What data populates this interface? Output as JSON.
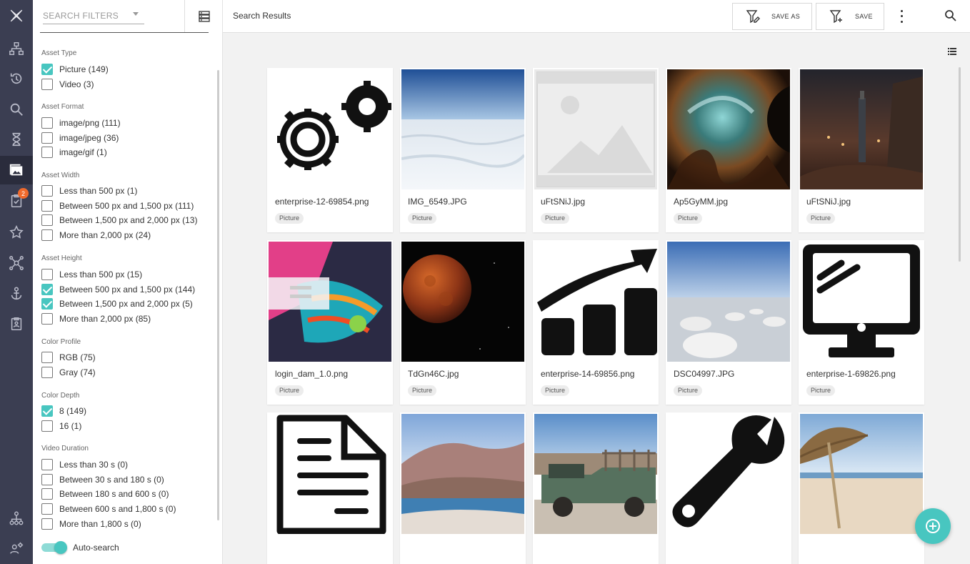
{
  "filters": {
    "search_placeholder": "SEARCH FILTERS",
    "groups": [
      {
        "title": "Asset Type",
        "options": [
          {
            "label": "Picture (149)",
            "checked": true
          },
          {
            "label": "Video (3)",
            "checked": false
          }
        ]
      },
      {
        "title": "Asset Format",
        "options": [
          {
            "label": "image/png (111)",
            "checked": false
          },
          {
            "label": "image/jpeg (36)",
            "checked": false
          },
          {
            "label": "image/gif (1)",
            "checked": false
          }
        ]
      },
      {
        "title": "Asset Width",
        "options": [
          {
            "label": "Less than 500 px (1)",
            "checked": false
          },
          {
            "label": "Between 500 px and 1,500 px (111)",
            "checked": false
          },
          {
            "label": "Between 1,500 px and 2,000 px (13)",
            "checked": false
          },
          {
            "label": "More than 2,000 px (24)",
            "checked": false
          }
        ]
      },
      {
        "title": "Asset Height",
        "options": [
          {
            "label": "Less than 500 px (15)",
            "checked": false
          },
          {
            "label": "Between 500 px and 1,500 px (144)",
            "checked": true
          },
          {
            "label": "Between 1,500 px and 2,000 px (5)",
            "checked": true
          },
          {
            "label": "More than 2,000 px (85)",
            "checked": false
          }
        ]
      },
      {
        "title": "Color Profile",
        "options": [
          {
            "label": "RGB (75)",
            "checked": false
          },
          {
            "label": "Gray (74)",
            "checked": false
          }
        ]
      },
      {
        "title": "Color Depth",
        "options": [
          {
            "label": "8 (149)",
            "checked": true
          },
          {
            "label": "16 (1)",
            "checked": false
          }
        ]
      },
      {
        "title": "Video Duration",
        "options": [
          {
            "label": "Less than 30 s (0)",
            "checked": false
          },
          {
            "label": "Between 30 s and 180 s (0)",
            "checked": false
          },
          {
            "label": "Between 180 s and 600 s (0)",
            "checked": false
          },
          {
            "label": "Between 600 s and 1,800 s (0)",
            "checked": false
          },
          {
            "label": "More than 1,800 s (0)",
            "checked": false
          }
        ]
      }
    ],
    "auto_search": {
      "label": "Auto-search",
      "enabled": true
    }
  },
  "header": {
    "title": "Search Results",
    "save_as_label": "SAVE AS",
    "save_label": "SAVE"
  },
  "rail": {
    "tasks_badge": "2",
    "items": [
      "logo-icon",
      "sitemap-icon",
      "history-icon",
      "search-icon",
      "hourglass-icon",
      "assets-icon",
      "tasks-icon",
      "star-icon",
      "network-icon",
      "anchor-icon",
      "clipboard-icon",
      "hierarchy-icon",
      "admin-gear-icon"
    ]
  },
  "results": [
    {
      "name": "enterprise-12-69854.png",
      "type": "Picture",
      "thumb": "gears-icon"
    },
    {
      "name": "IMG_6549.JPG",
      "type": "Picture",
      "thumb": "salt-flat-photo"
    },
    {
      "name": "uFtSNiJ.jpg",
      "type": "Picture",
      "thumb": "image-placeholder"
    },
    {
      "name": "Ap5GyMM.jpg",
      "type": "Picture",
      "thumb": "nebula-photo"
    },
    {
      "name": "uFtSNiJ.jpg",
      "type": "Picture",
      "thumb": "scifi-city-photo"
    },
    {
      "name": "login_dam_1.0.png",
      "type": "Picture",
      "thumb": "mandarin-fish-screenshot"
    },
    {
      "name": "TdGn46C.jpg",
      "type": "Picture",
      "thumb": "blood-moon-photo"
    },
    {
      "name": "enterprise-14-69856.png",
      "type": "Picture",
      "thumb": "growth-chart-icon"
    },
    {
      "name": "DSC04997.JPG",
      "type": "Picture",
      "thumb": "salt-mounds-photo"
    },
    {
      "name": "enterprise-1-69826.png",
      "type": "Picture",
      "thumb": "monitor-icon"
    },
    {
      "name": "",
      "type": "",
      "thumb": "document-icon"
    },
    {
      "name": "",
      "type": "",
      "thumb": "lake-mountain-photo"
    },
    {
      "name": "",
      "type": "",
      "thumb": "old-truck-photo"
    },
    {
      "name": "",
      "type": "",
      "thumb": "wrench-icon"
    },
    {
      "name": "",
      "type": "",
      "thumb": "beach-umbrella-photo"
    }
  ],
  "colors": {
    "rail": "#3b3e52",
    "accent": "#48c6c0",
    "badge": "#f06a2c"
  }
}
